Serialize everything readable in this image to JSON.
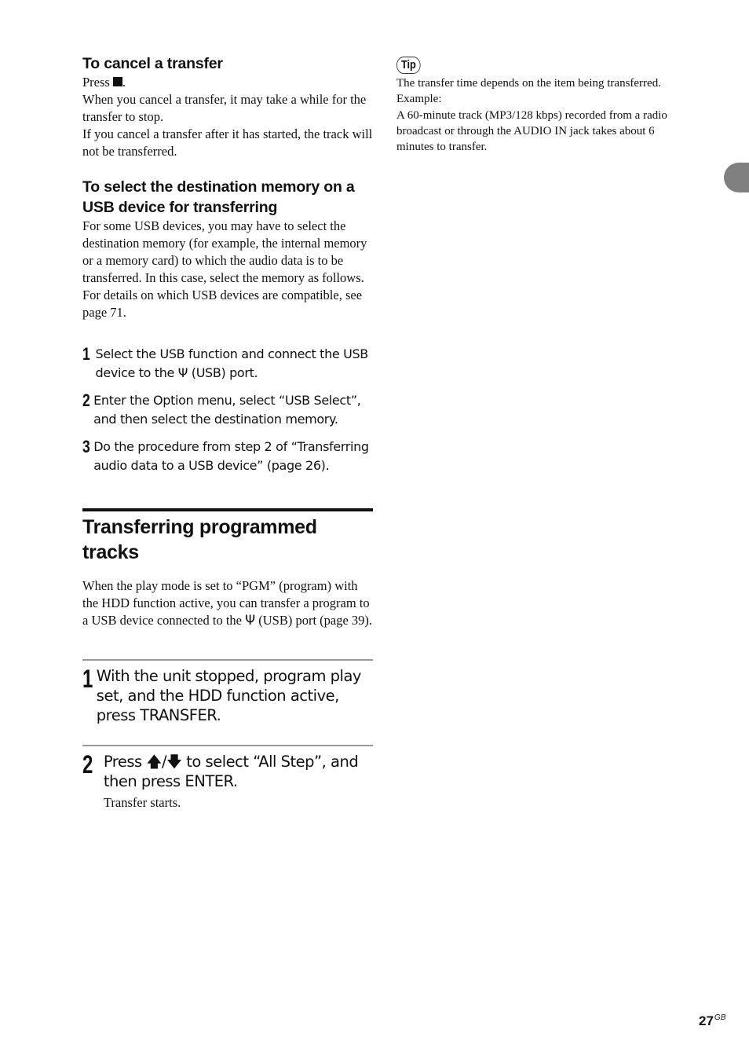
{
  "left": {
    "cancel": {
      "heading": "To cancel a transfer",
      "press_prefix": "Press",
      "press_suffix": ".",
      "stop_icon": "stop-square-icon",
      "para1": "When you cancel a transfer, it may take a while for the transfer to stop.",
      "para2": "If you cancel a transfer after it has started, the track will not be transferred."
    },
    "destination": {
      "heading": "To select the destination memory on a USB device for transferring",
      "para1": "For some USB devices, you may have to select the destination memory (for example, the internal memory or a memory card) to which the audio data is to be transferred. In this case, select the memory as follows.",
      "para2": "For details on which USB devices are compatible, see page 71.",
      "steps": [
        {
          "num": "1",
          "text_before": "Select the USB function and connect the USB device to the",
          "icon": "usb-icon",
          "text_after": "(USB) port."
        },
        {
          "num": "2",
          "text": "Enter the Option menu, select “USB Select”, and then select the destination memory."
        },
        {
          "num": "3",
          "text": "Do the procedure from step 2 of “Transferring audio data to a USB device” (page 26)."
        }
      ]
    },
    "section": {
      "title": "Transferring programmed tracks",
      "intro_before": "When the play mode is set to “PGM” (program) with the HDD function active, you can transfer a program to a USB device connected to the",
      "intro_after": "(USB) port (page 39).",
      "steps": [
        {
          "num": "1",
          "text": "With the unit stopped, program play set, and the HDD function active, press TRANSFER."
        },
        {
          "num": "2",
          "text_before": "Press",
          "up_icon": "up-arrow-icon",
          "separator": "/",
          "down_icon": "down-arrow-icon",
          "text_after": "to select “All Step”, and then press ENTER.",
          "result": "Transfer starts."
        }
      ]
    }
  },
  "right": {
    "tip": {
      "label": "Tip",
      "line1": "The transfer time depends on the item being transferred.",
      "line2": "Example:",
      "line3": "A 60-minute track (MP3/128 kbps) recorded from a radio broadcast or through the AUDIO IN jack takes about 6 minutes to transfer."
    }
  },
  "footer": {
    "page_number": "27",
    "region": "GB"
  },
  "colors": {
    "side_tab": "#808080",
    "text": "#111111",
    "rule_thin": "#999999"
  }
}
